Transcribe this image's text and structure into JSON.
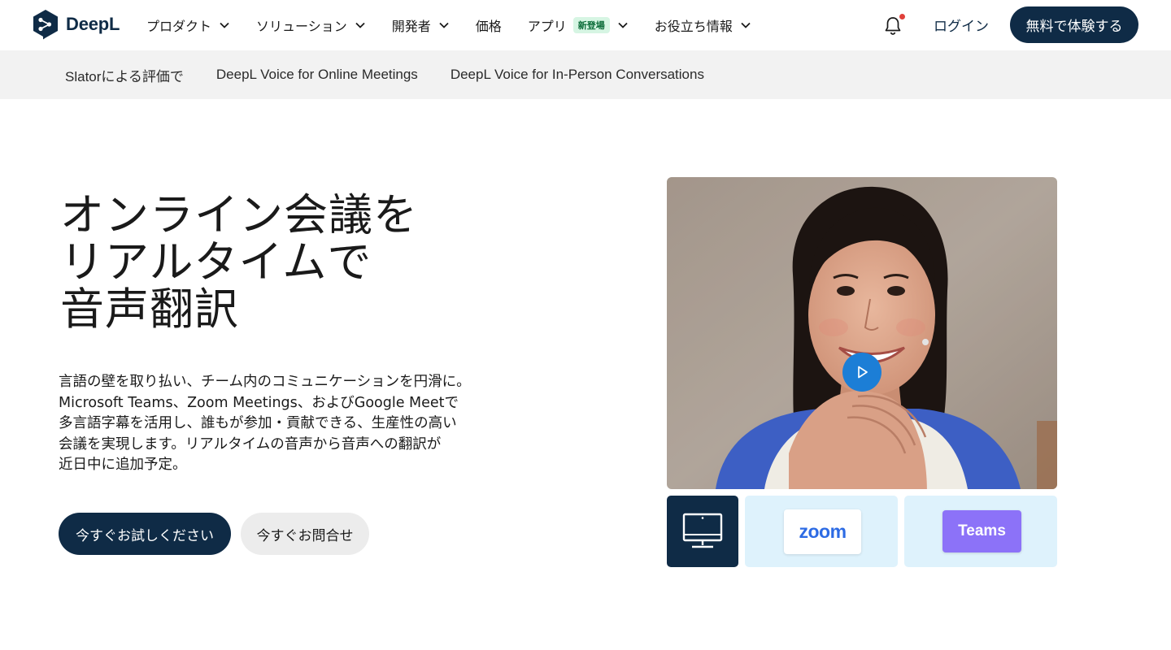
{
  "brand": {
    "name": "DeepL",
    "color": "#0f2b46"
  },
  "nav": {
    "items": [
      {
        "label": "プロダクト",
        "has_dropdown": true
      },
      {
        "label": "ソリューション",
        "has_dropdown": true
      },
      {
        "label": "開発者",
        "has_dropdown": true
      },
      {
        "label": "価格",
        "has_dropdown": false
      },
      {
        "label": "アプリ",
        "badge": "新登場",
        "has_dropdown": true
      },
      {
        "label": "お役立ち情報",
        "has_dropdown": true
      }
    ],
    "notification_icon": "bell-icon",
    "login_label": "ログイン",
    "trial_label": "無料で体験する"
  },
  "subnav": {
    "items": [
      "Slatorによる評価で",
      "DeepL Voice for Online Meetings",
      "DeepL Voice for In-Person Conversations"
    ]
  },
  "hero": {
    "title_lines": [
      "オンライン会議を",
      "リアルタイムで",
      "音声翻訳"
    ],
    "description_lines": [
      "言語の壁を取り払い、チーム内のコミュニケーションを円滑に。",
      "Microsoft Teams、Zoom Meetings、およびGoogle Meetで",
      "多言語字幕を活用し、誰もが参加・貢献できる、生産性の高い",
      "会議を実現します。リアルタイムの音声から音声への翻訳が",
      "近日中に追加予定。"
    ],
    "cta_primary": "今すぐお試しください",
    "cta_secondary": "今すぐお問合せ"
  },
  "media": {
    "play_icon": "play-icon",
    "tiles": [
      {
        "kind": "desktop",
        "icon": "monitor-icon"
      },
      {
        "kind": "zoom",
        "label": "zoom"
      },
      {
        "kind": "teams",
        "label": "Teams"
      }
    ]
  },
  "colors": {
    "primary": "#0f2b46",
    "subnav_bg": "#f2f2f2",
    "tile_bg": "#def2fc",
    "play": "#1c7ed6",
    "teams": "#8c72f8",
    "zoom": "#2d6be4",
    "badge_bg": "#d6f5e3",
    "notification_dot": "#e0403a"
  }
}
